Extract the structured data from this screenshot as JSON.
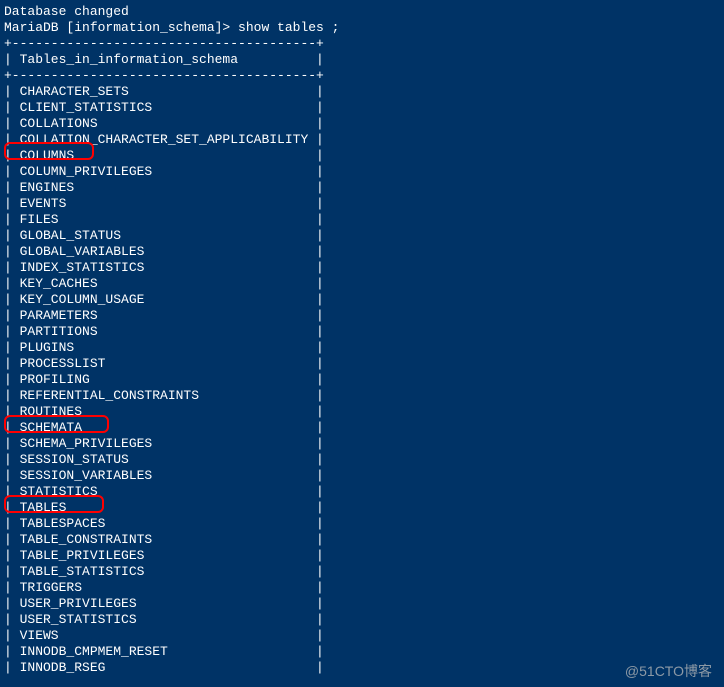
{
  "status_line": "Database changed",
  "prompt": "MariaDB [information_schema]> ",
  "command": "show tables ;",
  "border_top": "+---------------------------------------+",
  "header": "Tables_in_information_schema",
  "border_mid": "+---------------------------------------+",
  "rows": [
    "CHARACTER_SETS",
    "CLIENT_STATISTICS",
    "COLLATIONS",
    "COLLATION_CHARACTER_SET_APPLICABILITY",
    "COLUMNS",
    "COLUMN_PRIVILEGES",
    "ENGINES",
    "EVENTS",
    "FILES",
    "GLOBAL_STATUS",
    "GLOBAL_VARIABLES",
    "INDEX_STATISTICS",
    "KEY_CACHES",
    "KEY_COLUMN_USAGE",
    "PARAMETERS",
    "PARTITIONS",
    "PLUGINS",
    "PROCESSLIST",
    "PROFILING",
    "REFERENTIAL_CONSTRAINTS",
    "ROUTINES",
    "SCHEMATA",
    "SCHEMA_PRIVILEGES",
    "SESSION_STATUS",
    "SESSION_VARIABLES",
    "STATISTICS",
    "TABLES",
    "TABLESPACES",
    "TABLE_CONSTRAINTS",
    "TABLE_PRIVILEGES",
    "TABLE_STATISTICS",
    "TRIGGERS",
    "USER_PRIVILEGES",
    "USER_STATISTICS",
    "VIEWS",
    "INNODB_CMPMEM_RESET",
    "INNODB_RSEG"
  ],
  "highlighted_rows": [
    "COLUMNS",
    "SCHEMATA",
    "TABLES"
  ],
  "watermark": "@51CTO博客"
}
